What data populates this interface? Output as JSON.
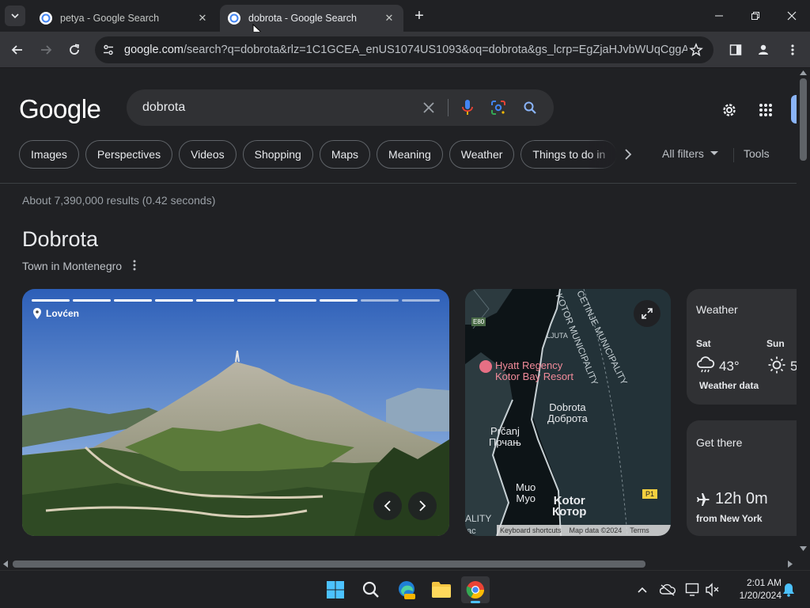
{
  "tabs": [
    {
      "title": "petya - Google Search",
      "active": false
    },
    {
      "title": "dobrota - Google Search",
      "active": true
    }
  ],
  "address": {
    "host": "google.com",
    "path": "/search?q=dobrota&rlz=1C1GCEA_enUS1074US1093&oq=dobrota&gs_lcrp=EgZjaHJvbWUqCggAEA..."
  },
  "search": {
    "logo": "Google",
    "query": "dobrota"
  },
  "chips": [
    "Images",
    "Perspectives",
    "Videos",
    "Shopping",
    "Maps",
    "Meaning",
    "Weather",
    "Things to do in"
  ],
  "filters": {
    "all_filters": "All filters",
    "tools": "Tools"
  },
  "result_stats": "About 7,390,000 results (0.42 seconds)",
  "knowledge_panel": {
    "title": "Dobrota",
    "subtitle": "Town in Montenegro",
    "photo": {
      "place": "Lovćen",
      "slides_total": 10,
      "slides_viewed": 8
    },
    "map": {
      "labels": {
        "municipality_a": "KOTOR MUNICIPALITY",
        "municipality_b": "CETINJE MUNICIPALITY",
        "ljuta": "LJUTA",
        "hotel": "Hyatt Regency\nKotor Bay Resort",
        "dobrota": "Dobrota\nДоброта",
        "prcanj": "Prčanj\nПрчањ",
        "muo": "Muo\nМуо",
        "kotor": "Kotor\nКотор",
        "road_e80": "E80",
        "road_p1": "P1",
        "edge_left": "ALITY",
        "edge_bottom": "ac"
      },
      "attribution": [
        "Keyboard shortcuts",
        "Map data ©2024",
        "Terms"
      ]
    },
    "weather_card": {
      "title": "Weather",
      "days": [
        {
          "day": "Sat",
          "temp": "43°",
          "icon": "rain-icon"
        },
        {
          "day": "Sun",
          "temp": "5",
          "icon": "sun-icon"
        }
      ],
      "source": "Weather data"
    },
    "travel_card": {
      "title": "Get there",
      "duration": "12h 0m",
      "origin": "from New York"
    }
  },
  "taskbar": {
    "clock_time": "2:01 AM",
    "clock_date": "1/20/2024"
  }
}
